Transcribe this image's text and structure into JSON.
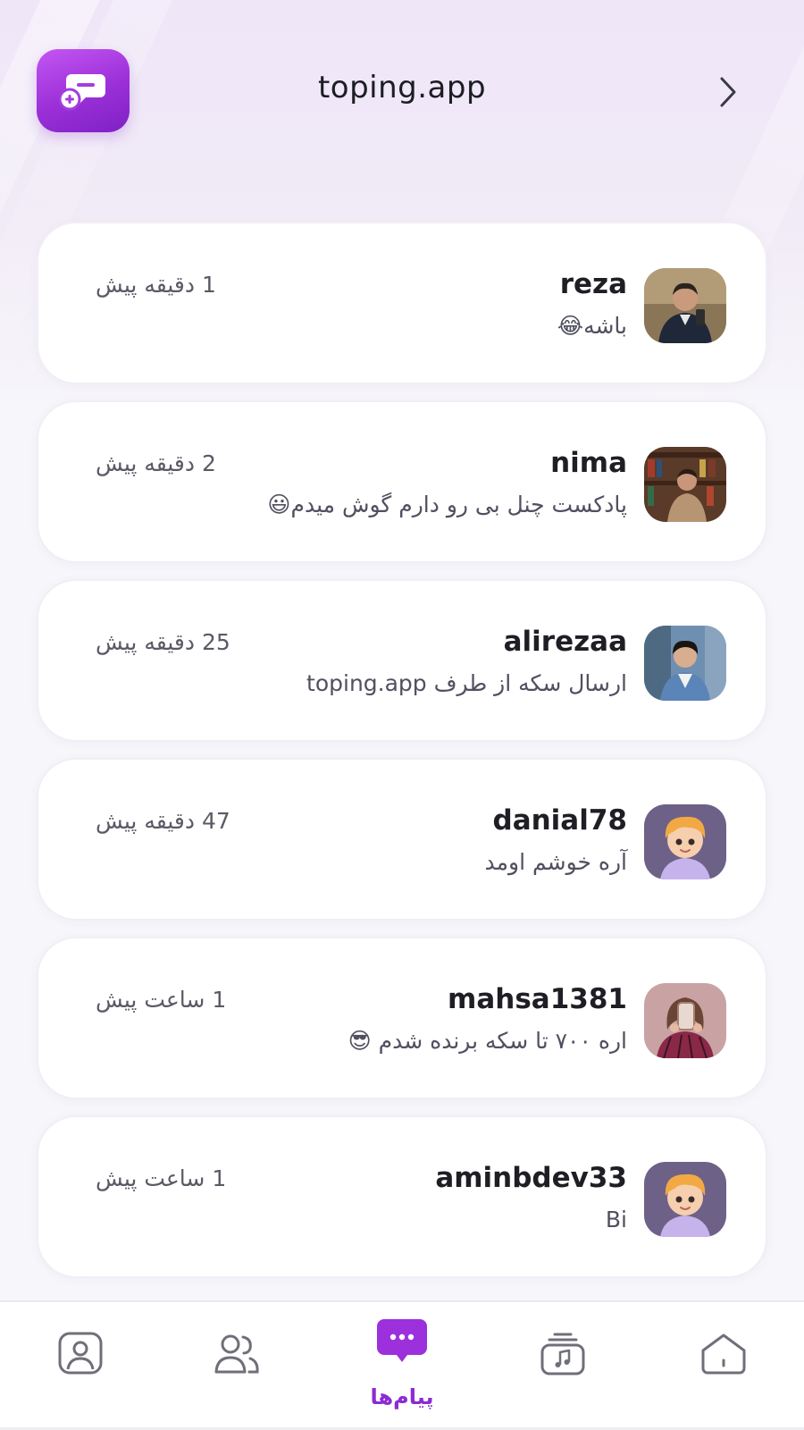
{
  "header": {
    "title": "toping.app"
  },
  "chats": [
    {
      "username": "reza",
      "message": "باشه😂",
      "time": "1 دقیقه پیش"
    },
    {
      "username": "nima",
      "message": "پادکست چنل بی رو دارم گوش میدم😃",
      "time": "2 دقیقه پیش"
    },
    {
      "username": "alirezaa",
      "message": "ارسال سکه از طرف toping.app",
      "time": "25 دقیقه پیش"
    },
    {
      "username": "danial78",
      "message": "آره خوشم اومد",
      "time": "47 دقیقه پیش"
    },
    {
      "username": "mahsa1381",
      "message": "اره ۷۰۰ تا سکه برنده شدم 😎",
      "time": "1 ساعت پیش"
    },
    {
      "username": "aminbdev33",
      "message": "Bi",
      "time": "1 ساعت پیش"
    }
  ],
  "bottom_nav": {
    "active_label": "پیام‌ها",
    "items": [
      "profile-icon",
      "friends-icon",
      "messages-icon",
      "music-icon",
      "home-icon"
    ]
  },
  "colors": {
    "accent": "#8c2bd2",
    "card_bg": "#ffffff",
    "page_bg": "#f7f6fa"
  }
}
